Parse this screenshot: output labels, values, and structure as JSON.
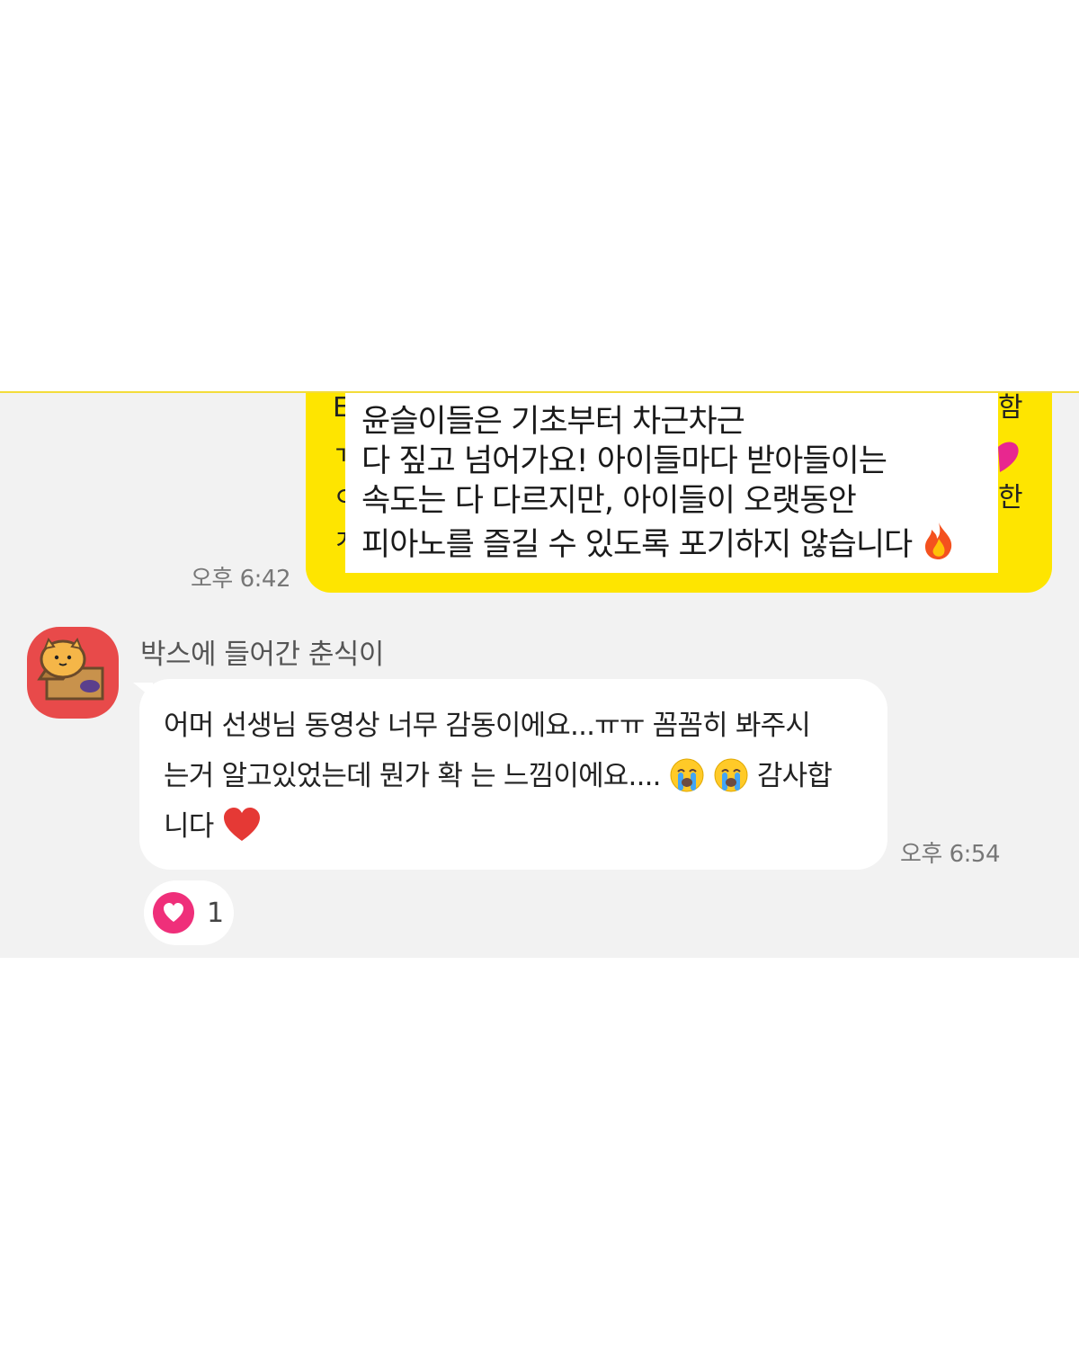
{
  "colors": {
    "my_bubble": "#fee500",
    "chat_background": "#f2f2f2",
    "avatar_background": "#e84a4a",
    "reaction_heart": "#ef2f7a"
  },
  "outgoing": {
    "edge_chars_left": [
      "E",
      "ㄲ",
      "ㅇ",
      "ㅈ"
    ],
    "edge_chars_right": [
      "함",
      "한"
    ],
    "overlay_lines": [
      "윤슬이들은 기초부터 차근차근",
      "다 짚고 넘어가요! 아이들마다 받아들이는",
      "속도는 다 다르지만, 아이들이 오랫동안",
      "피아노를 즐길 수 있도록 포기하지 않습니다"
    ],
    "overlay_emoji": "fire-emoji",
    "time": "오후 6:42"
  },
  "incoming": {
    "avatar_icon": "cat-in-box-avatar",
    "sender": "박스에 들어간 춘식이",
    "lines": [
      "어머 선생님 동영상 너무 감동이에요...ㅠㅠ 꼼꼼히 봐주시",
      "는거 알고있었는데 뭔가 확 는 느낌이에요....",
      "감사합",
      "니다"
    ],
    "emojis": [
      "crying-face-emoji",
      "crying-face-emoji",
      "red-heart-emoji"
    ],
    "time": "오후 6:54",
    "reaction": {
      "icon": "heart-icon",
      "count": "1"
    }
  }
}
